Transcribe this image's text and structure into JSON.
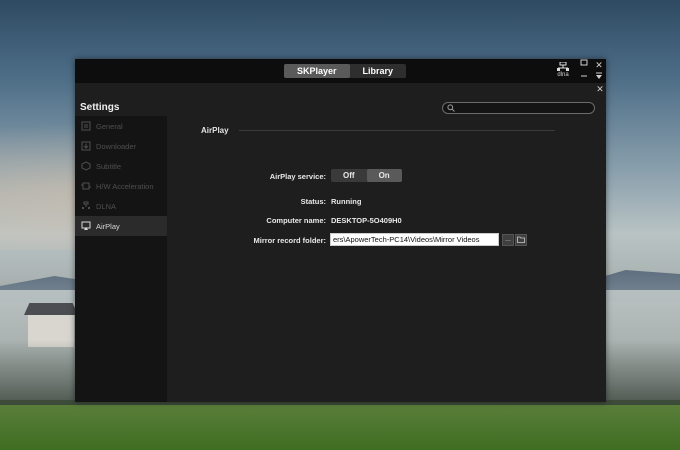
{
  "app": {
    "tabs": [
      {
        "label": "SKPlayer",
        "active": true
      },
      {
        "label": "Library",
        "active": false
      }
    ],
    "dlna_label": "dlna",
    "window_controls": {
      "close": "✕",
      "minimize": "—",
      "pin": "⇩"
    }
  },
  "settings": {
    "title": "Settings",
    "close": "✕",
    "search": {
      "placeholder": "",
      "value": ""
    },
    "nav": [
      {
        "label": "General",
        "icon": "general-icon",
        "active": false
      },
      {
        "label": "Downloader",
        "icon": "download-icon",
        "active": false
      },
      {
        "label": "Subtitle",
        "icon": "subtitle-icon",
        "active": false
      },
      {
        "label": "H/W Acceleration",
        "icon": "chip-icon",
        "active": false
      },
      {
        "label": "DLNA",
        "icon": "dlna-icon",
        "active": false
      },
      {
        "label": "AirPlay",
        "icon": "airplay-icon",
        "active": true
      }
    ]
  },
  "airplay": {
    "section_title": "AirPlay",
    "service": {
      "label": "AirPlay service:",
      "off": "Off",
      "on": "On",
      "selected": "On"
    },
    "status": {
      "label": "Status:",
      "value": "Running"
    },
    "computer_name": {
      "label": "Computer name:",
      "value": "DESKTOP-5O409H0"
    },
    "mirror_folder": {
      "label": "Mirror record folder:",
      "value": "ers\\ApowerTech-PC14\\Videos\\Mirror Videos",
      "more_button": "...",
      "folder_icon": "folder-open-icon"
    }
  },
  "colors": {
    "window_bg": "#1e1e1e",
    "sidebar_bg": "#141414",
    "accent_active": "#5a5a5a"
  }
}
